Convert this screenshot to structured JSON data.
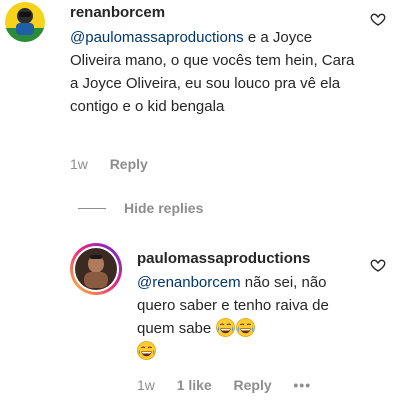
{
  "comments": [
    {
      "username": "renanborcem",
      "mention": "@paulomassaproductions",
      "text": " e a Joyce Oliveira mano, o que vocês tem hein, Cara a Joyce Oliveira, eu sou louco pra vê ela contigo e o kid bengala",
      "time": "1w",
      "reply_label": "Reply"
    },
    {
      "username": "paulomassaproductions",
      "mention": "@renanborcem",
      "text": " não sei, não quero saber e tenho raiva de quem sabe ",
      "emojis": [
        "😂",
        "😂",
        "😂"
      ],
      "time": "1w",
      "likes": "1 like",
      "reply_label": "Reply",
      "more_label": "•••"
    }
  ],
  "hide_replies_label": "Hide replies",
  "icons": {
    "like": "heart-icon",
    "emoji": "face-with-tears-of-joy"
  },
  "colors": {
    "text": "#262626",
    "mention": "#00376b",
    "muted": "#8e8e8e"
  }
}
